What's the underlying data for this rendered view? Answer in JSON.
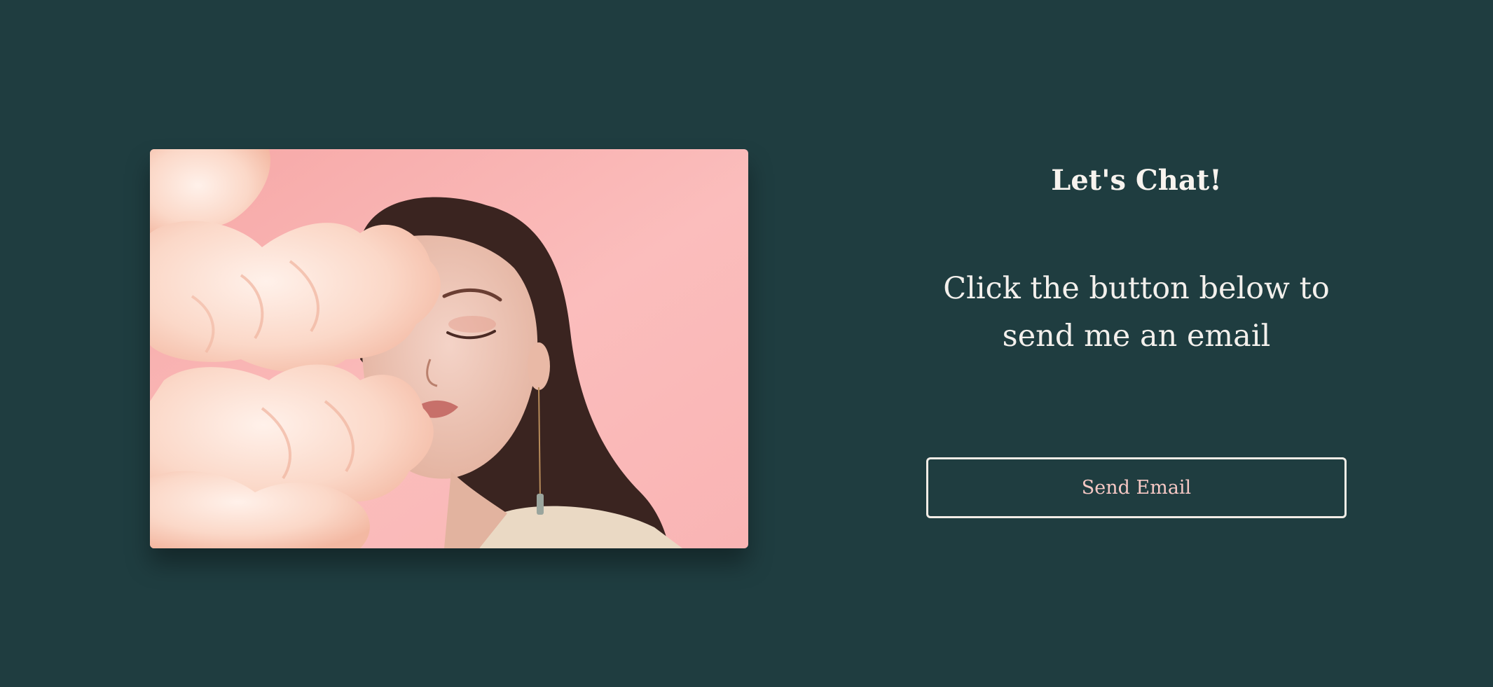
{
  "colors": {
    "background": "#1f3d40",
    "text": "#f3f0ec",
    "button_border": "#f1ece6",
    "button_text": "#f5c8c4",
    "photo_backdrop": "#fbb9b9"
  },
  "photo": {
    "subject": "portrait of a woman with eyes closed beside pale peach flowers on a pink backdrop"
  },
  "contact": {
    "heading": "Let's Chat!",
    "body": "Click the button below to send me an email",
    "button_label": "Send Email"
  }
}
